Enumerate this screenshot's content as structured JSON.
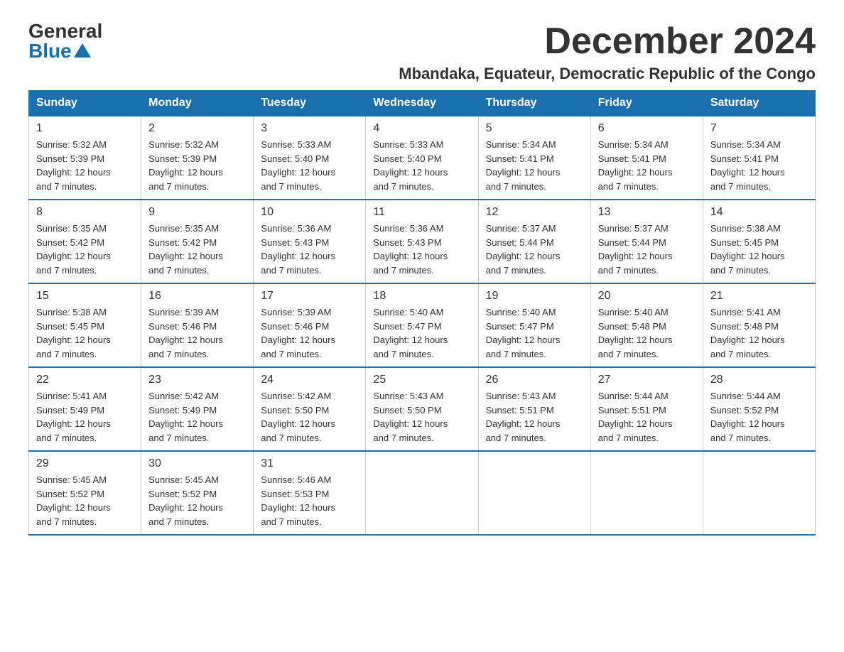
{
  "logo": {
    "general": "General",
    "blue": "Blue"
  },
  "title": "December 2024",
  "location": "Mbandaka, Equateur, Democratic Republic of the Congo",
  "weekdays": [
    "Sunday",
    "Monday",
    "Tuesday",
    "Wednesday",
    "Thursday",
    "Friday",
    "Saturday"
  ],
  "weeks": [
    [
      {
        "day": "1",
        "sunrise": "5:32 AM",
        "sunset": "5:39 PM",
        "daylight": "12 hours and 7 minutes."
      },
      {
        "day": "2",
        "sunrise": "5:32 AM",
        "sunset": "5:39 PM",
        "daylight": "12 hours and 7 minutes."
      },
      {
        "day": "3",
        "sunrise": "5:33 AM",
        "sunset": "5:40 PM",
        "daylight": "12 hours and 7 minutes."
      },
      {
        "day": "4",
        "sunrise": "5:33 AM",
        "sunset": "5:40 PM",
        "daylight": "12 hours and 7 minutes."
      },
      {
        "day": "5",
        "sunrise": "5:34 AM",
        "sunset": "5:41 PM",
        "daylight": "12 hours and 7 minutes."
      },
      {
        "day": "6",
        "sunrise": "5:34 AM",
        "sunset": "5:41 PM",
        "daylight": "12 hours and 7 minutes."
      },
      {
        "day": "7",
        "sunrise": "5:34 AM",
        "sunset": "5:41 PM",
        "daylight": "12 hours and 7 minutes."
      }
    ],
    [
      {
        "day": "8",
        "sunrise": "5:35 AM",
        "sunset": "5:42 PM",
        "daylight": "12 hours and 7 minutes."
      },
      {
        "day": "9",
        "sunrise": "5:35 AM",
        "sunset": "5:42 PM",
        "daylight": "12 hours and 7 minutes."
      },
      {
        "day": "10",
        "sunrise": "5:36 AM",
        "sunset": "5:43 PM",
        "daylight": "12 hours and 7 minutes."
      },
      {
        "day": "11",
        "sunrise": "5:36 AM",
        "sunset": "5:43 PM",
        "daylight": "12 hours and 7 minutes."
      },
      {
        "day": "12",
        "sunrise": "5:37 AM",
        "sunset": "5:44 PM",
        "daylight": "12 hours and 7 minutes."
      },
      {
        "day": "13",
        "sunrise": "5:37 AM",
        "sunset": "5:44 PM",
        "daylight": "12 hours and 7 minutes."
      },
      {
        "day": "14",
        "sunrise": "5:38 AM",
        "sunset": "5:45 PM",
        "daylight": "12 hours and 7 minutes."
      }
    ],
    [
      {
        "day": "15",
        "sunrise": "5:38 AM",
        "sunset": "5:45 PM",
        "daylight": "12 hours and 7 minutes."
      },
      {
        "day": "16",
        "sunrise": "5:39 AM",
        "sunset": "5:46 PM",
        "daylight": "12 hours and 7 minutes."
      },
      {
        "day": "17",
        "sunrise": "5:39 AM",
        "sunset": "5:46 PM",
        "daylight": "12 hours and 7 minutes."
      },
      {
        "day": "18",
        "sunrise": "5:40 AM",
        "sunset": "5:47 PM",
        "daylight": "12 hours and 7 minutes."
      },
      {
        "day": "19",
        "sunrise": "5:40 AM",
        "sunset": "5:47 PM",
        "daylight": "12 hours and 7 minutes."
      },
      {
        "day": "20",
        "sunrise": "5:40 AM",
        "sunset": "5:48 PM",
        "daylight": "12 hours and 7 minutes."
      },
      {
        "day": "21",
        "sunrise": "5:41 AM",
        "sunset": "5:48 PM",
        "daylight": "12 hours and 7 minutes."
      }
    ],
    [
      {
        "day": "22",
        "sunrise": "5:41 AM",
        "sunset": "5:49 PM",
        "daylight": "12 hours and 7 minutes."
      },
      {
        "day": "23",
        "sunrise": "5:42 AM",
        "sunset": "5:49 PM",
        "daylight": "12 hours and 7 minutes."
      },
      {
        "day": "24",
        "sunrise": "5:42 AM",
        "sunset": "5:50 PM",
        "daylight": "12 hours and 7 minutes."
      },
      {
        "day": "25",
        "sunrise": "5:43 AM",
        "sunset": "5:50 PM",
        "daylight": "12 hours and 7 minutes."
      },
      {
        "day": "26",
        "sunrise": "5:43 AM",
        "sunset": "5:51 PM",
        "daylight": "12 hours and 7 minutes."
      },
      {
        "day": "27",
        "sunrise": "5:44 AM",
        "sunset": "5:51 PM",
        "daylight": "12 hours and 7 minutes."
      },
      {
        "day": "28",
        "sunrise": "5:44 AM",
        "sunset": "5:52 PM",
        "daylight": "12 hours and 7 minutes."
      }
    ],
    [
      {
        "day": "29",
        "sunrise": "5:45 AM",
        "sunset": "5:52 PM",
        "daylight": "12 hours and 7 minutes."
      },
      {
        "day": "30",
        "sunrise": "5:45 AM",
        "sunset": "5:52 PM",
        "daylight": "12 hours and 7 minutes."
      },
      {
        "day": "31",
        "sunrise": "5:46 AM",
        "sunset": "5:53 PM",
        "daylight": "12 hours and 7 minutes."
      },
      null,
      null,
      null,
      null
    ]
  ],
  "labels": {
    "sunrise": "Sunrise:",
    "sunset": "Sunset:",
    "daylight": "Daylight:"
  },
  "colors": {
    "header_bg": "#1a6faf",
    "header_text": "#ffffff",
    "border": "#1a6faf"
  }
}
